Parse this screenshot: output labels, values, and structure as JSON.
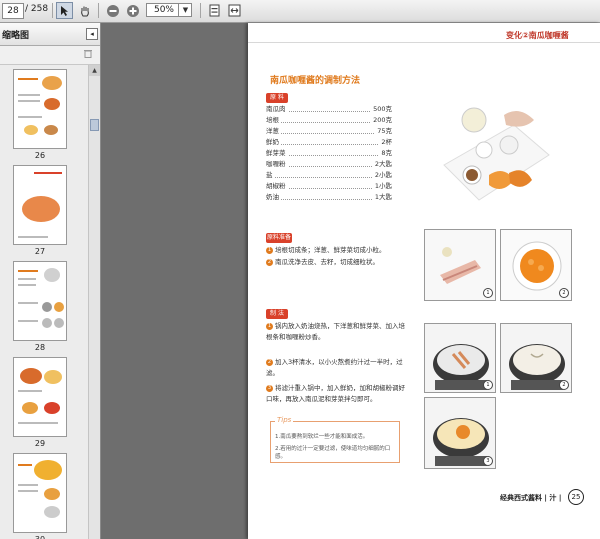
{
  "toolbar": {
    "page_current": "28",
    "page_total": "/ 258",
    "zoom": "50%",
    "select_icon": "select-arrow-icon",
    "hand_icon": "hand-icon",
    "zoom_out_icon": "zoom-out-icon",
    "zoom_in_icon": "zoom-in-icon"
  },
  "sidebar": {
    "title": "缩略图",
    "thumbnails": [
      {
        "label": "26"
      },
      {
        "label": "27"
      },
      {
        "label": "28"
      },
      {
        "label": "29"
      },
      {
        "label": "30"
      }
    ]
  },
  "page": {
    "header": "变化②南瓜咖喱酱",
    "title": "南瓜咖喱酱的调制方法",
    "ingredients_badge": "原 料",
    "ingredients": [
      {
        "name": "南瓜肉",
        "amount": "500克"
      },
      {
        "name": "培根",
        "amount": "200克"
      },
      {
        "name": "洋葱",
        "amount": "75克"
      },
      {
        "name": "鲜奶",
        "amount": "2杯"
      },
      {
        "name": "鲜芽菜",
        "amount": "8克"
      },
      {
        "name": "咖喱粉",
        "amount": "2大匙"
      },
      {
        "name": "盐",
        "amount": "2小匙"
      },
      {
        "name": "胡椒粉",
        "amount": "1小匙"
      },
      {
        "name": "奶油",
        "amount": "1大匙"
      }
    ],
    "prep_badge": "原料准备",
    "prep_steps": [
      "培根切成条；洋葱、鲜芽菜切成小粒。",
      "南瓜洗净去皮、去籽，切成细粒状。"
    ],
    "method_badge": "制 法",
    "method_steps": [
      "锅内放入奶油烧热，下洋葱和鲜芽菜、加入培根条和咖喱粉炒香。",
      "加入3杯清水，以小火熬煮约汁过一半时，过滤。",
      "将滤汁重入锅中，加入鲜奶，加和胡椒粉调好口味，再放入南瓜泥和芽菜拌匀即可。"
    ],
    "tips_label": "Tips",
    "tips": [
      "1.南瓜要熬到软烂一些才能和面成活。",
      "2.若用的过汁一定要过滤，使味道均匀细腻的口感。"
    ],
    "footer": "经典西式酱料 | 汁 |",
    "page_number": "25",
    "photo_numbers": [
      "1",
      "2",
      "1",
      "2",
      "3"
    ]
  },
  "colors": {
    "accent": "#e07b1e",
    "header_red": "#c0392b",
    "badge_red": "#d9412a"
  }
}
